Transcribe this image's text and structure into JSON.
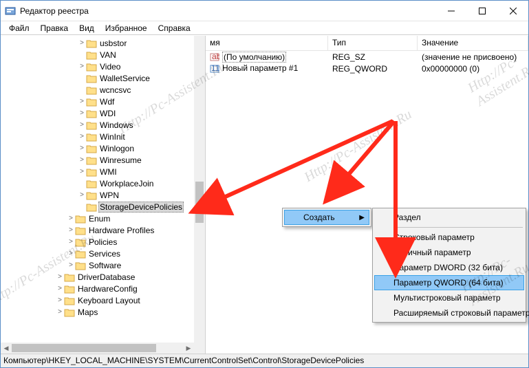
{
  "window": {
    "title": "Редактор реестра"
  },
  "menu": {
    "file": "Файл",
    "edit": "Правка",
    "view": "Вид",
    "fav": "Избранное",
    "help": "Справка"
  },
  "tree": {
    "items": [
      {
        "indent": 112,
        "exp": ">",
        "label": "usbstor"
      },
      {
        "indent": 112,
        "exp": "",
        "label": "VAN"
      },
      {
        "indent": 112,
        "exp": ">",
        "label": "Video"
      },
      {
        "indent": 112,
        "exp": "",
        "label": "WalletService"
      },
      {
        "indent": 112,
        "exp": "",
        "label": "wcncsvc"
      },
      {
        "indent": 112,
        "exp": ">",
        "label": "Wdf"
      },
      {
        "indent": 112,
        "exp": ">",
        "label": "WDI"
      },
      {
        "indent": 112,
        "exp": ">",
        "label": "Windows"
      },
      {
        "indent": 112,
        "exp": ">",
        "label": "WinInit"
      },
      {
        "indent": 112,
        "exp": ">",
        "label": "Winlogon"
      },
      {
        "indent": 112,
        "exp": ">",
        "label": "Winresume"
      },
      {
        "indent": 112,
        "exp": ">",
        "label": "WMI"
      },
      {
        "indent": 112,
        "exp": "",
        "label": "WorkplaceJoin"
      },
      {
        "indent": 112,
        "exp": ">",
        "label": "WPN"
      },
      {
        "indent": 112,
        "exp": "",
        "label": "StorageDevicePolicies",
        "selected": true
      },
      {
        "indent": 96,
        "exp": ">",
        "label": "Enum"
      },
      {
        "indent": 96,
        "exp": ">",
        "label": "Hardware Profiles"
      },
      {
        "indent": 96,
        "exp": ">",
        "label": "Policies"
      },
      {
        "indent": 96,
        "exp": ">",
        "label": "Services"
      },
      {
        "indent": 96,
        "exp": ">",
        "label": "Software"
      },
      {
        "indent": 80,
        "exp": ">",
        "label": "DriverDatabase"
      },
      {
        "indent": 80,
        "exp": ">",
        "label": "HardwareConfig"
      },
      {
        "indent": 80,
        "exp": ">",
        "label": "Keyboard Layout"
      },
      {
        "indent": 80,
        "exp": ">",
        "label": "Maps"
      }
    ]
  },
  "list": {
    "cols": {
      "name": "мя",
      "type": "Тип",
      "value": "Значение"
    },
    "rows": [
      {
        "name": "(По умолчанию)",
        "type": "REG_SZ",
        "value": "(значение не присвоено)",
        "kind": "sz",
        "default": true
      },
      {
        "name": "Новый параметр #1",
        "type": "REG_QWORD",
        "value": "0x00000000 (0)",
        "kind": "bin"
      }
    ]
  },
  "ctx_create": {
    "label": "Создать"
  },
  "ctx_sub": {
    "section": "Раздел",
    "str": "Строковый параметр",
    "bin": "Двоичный параметр",
    "dword": "Параметр DWORD (32 бита)",
    "qword": "Параметр QWORD (64 бита)",
    "multi": "Мультистроковый параметр",
    "expand": "Расширяемый строковый параметр"
  },
  "statusbar": "Компьютер\\HKEY_LOCAL_MACHINE\\SYSTEM\\CurrentControlSet\\Control\\StorageDevicePolicies",
  "watermark": "Http://Pc-Assistent.Ru"
}
